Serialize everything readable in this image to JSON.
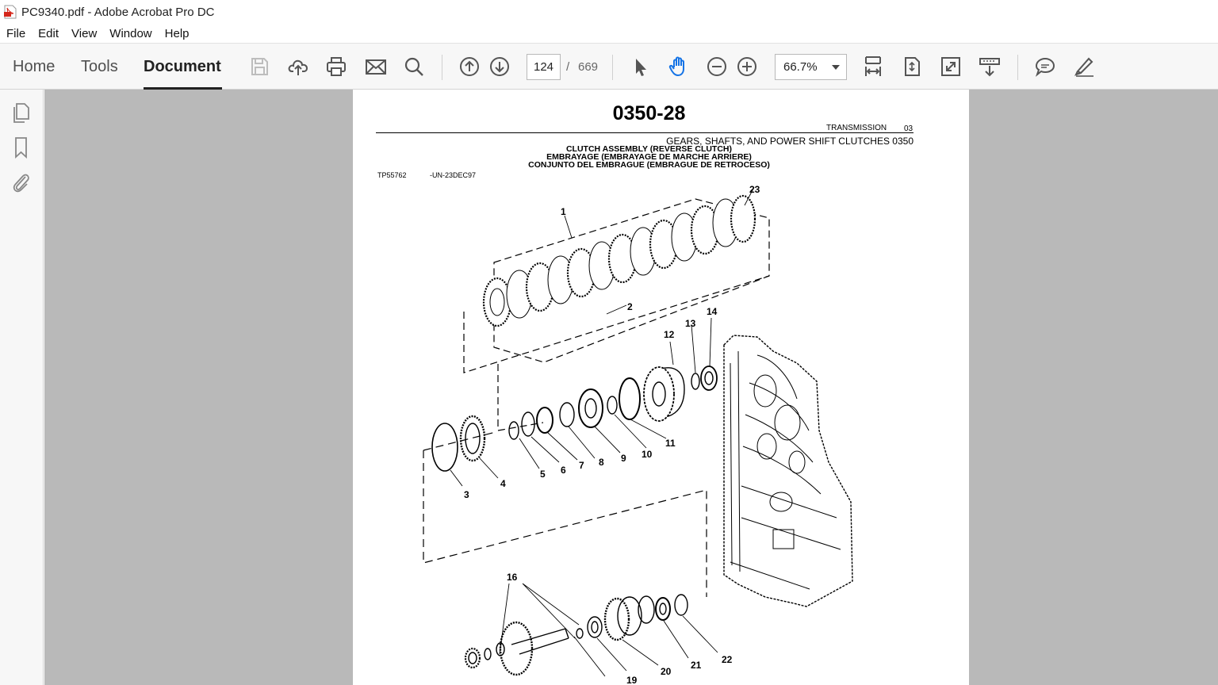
{
  "window": {
    "title": "PC9340.pdf - Adobe Acrobat Pro DC"
  },
  "menu": [
    "File",
    "Edit",
    "View",
    "Window",
    "Help"
  ],
  "nav_tabs": [
    "Home",
    "Tools",
    "Document"
  ],
  "toolbar": {
    "page_current": "124",
    "page_separator": "/",
    "page_total": "669",
    "zoom": "66.7%",
    "icons": [
      "save-icon",
      "upload-cloud-icon",
      "print-icon",
      "email-icon",
      "search-icon",
      "page-up-icon",
      "page-down-icon",
      "select-cursor-icon",
      "hand-tool-icon",
      "zoom-out-icon",
      "zoom-in-icon",
      "fit-width-icon",
      "fit-page-icon",
      "full-screen-icon",
      "scrolling-mode-icon",
      "comment-icon",
      "highlight-pen-icon"
    ]
  },
  "left_panel": {
    "icons": [
      "page-thumbnails-icon",
      "bookmarks-icon",
      "attachments-icon"
    ]
  },
  "pdf_page": {
    "page_label": "0350-28",
    "section_group": "TRANSMISSION",
    "section_group_num": "03",
    "section_title": "GEARS, SHAFTS, AND POWER SHIFT CLUTCHES 0350",
    "headings": [
      "CLUTCH ASSEMBLY (REVERSE CLUTCH)",
      "EMBRAYAGE (EMBRAYAGE DE MARCHE ARRIERE)",
      "CONJUNTO DEL EMBRAGUE (EMBRAGUE DE RETROCESO)"
    ],
    "figure_ref": "TP55762",
    "figure_code": "-UN-23DEC97",
    "callouts": [
      "1",
      "2",
      "3",
      "4",
      "5",
      "6",
      "7",
      "8",
      "9",
      "10",
      "11",
      "12",
      "13",
      "14",
      "16",
      "19",
      "20",
      "21",
      "22",
      "23"
    ]
  }
}
